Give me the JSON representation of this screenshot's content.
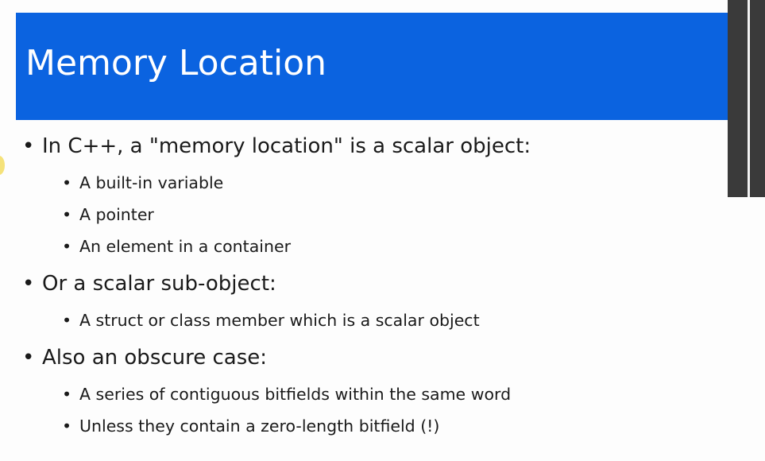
{
  "slide": {
    "title": "Memory Location",
    "bullets": [
      {
        "text": "In C++, a \"memory location\" is a scalar object:",
        "level": 1
      },
      {
        "text": "A built-in variable",
        "level": 2
      },
      {
        "text": "A pointer",
        "level": 2
      },
      {
        "text": "An element in a container",
        "level": 2
      },
      {
        "text": "Or a scalar sub-object:",
        "level": 1
      },
      {
        "text": "A struct or class member which is a scalar object",
        "level": 2
      },
      {
        "text": "Also an obscure case:",
        "level": 1
      },
      {
        "text": "A series of contiguous bitfields within the same word",
        "level": 2
      },
      {
        "text": "Unless they contain a zero-length bitfield (!)",
        "level": 2
      }
    ],
    "bullet_glyph": "•"
  },
  "colors": {
    "title_bar": "#0b63e0",
    "title_text": "#ffffff",
    "body_text": "#1a1a1a",
    "side_panel": "#3a3a3a"
  }
}
